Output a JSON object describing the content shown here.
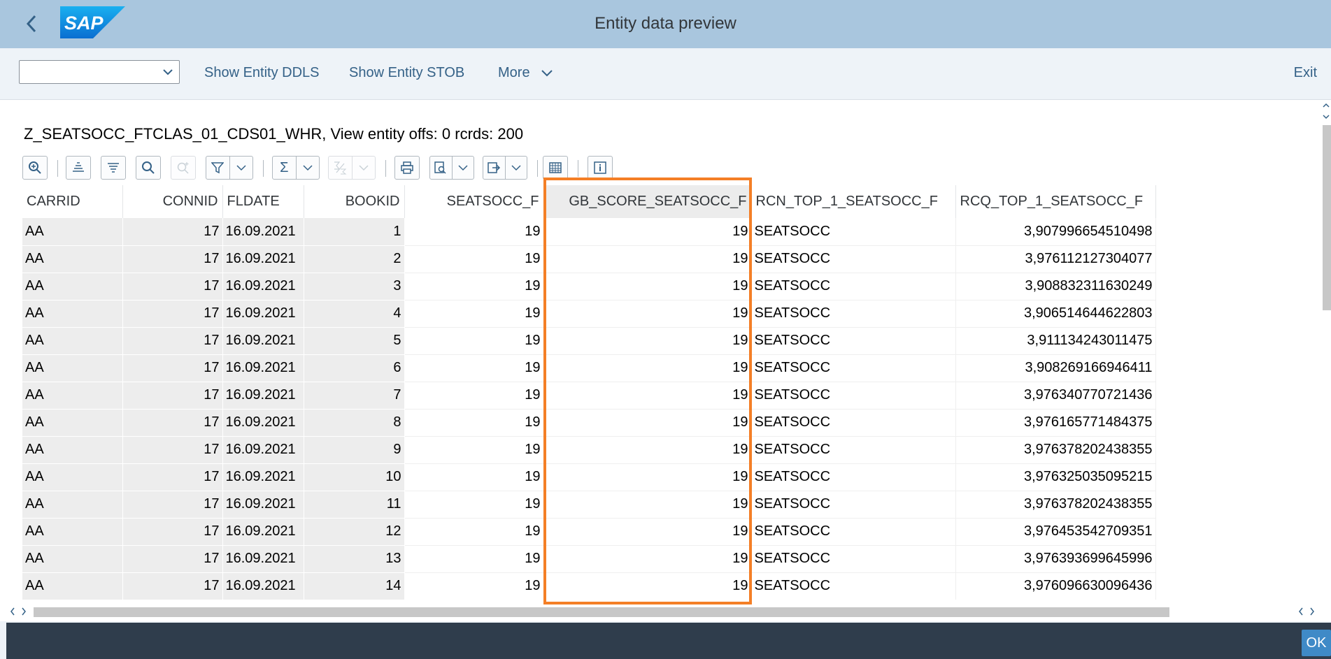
{
  "header": {
    "title": "Entity data preview",
    "logo_text": "SAP",
    "brand_color": "#0a6ed1"
  },
  "toolbar": {
    "select_value": "",
    "show_ddls": "Show Entity DDLS",
    "show_stob": "Show Entity STOB",
    "more": "More",
    "exit": "Exit"
  },
  "grid": {
    "title": "Z_SEATSOCC_FTCLAS_01_CDS01_WHR, View entity offs: 0  rcrds: 200",
    "columns": [
      "CARRID",
      "CONNID",
      "FLDATE",
      "BOOKID",
      "SEATSOCC_F",
      "GB_SCORE_SEATSOCC_F",
      "RCN_TOP_1_SEATSOCC_F",
      "RCQ_TOP_1_SEATSOCC_F"
    ],
    "rows": [
      [
        "AA",
        "17",
        "16.09.2021",
        "1",
        "19",
        "19",
        "SEATSOCC",
        "3,907996654510498"
      ],
      [
        "AA",
        "17",
        "16.09.2021",
        "2",
        "19",
        "19",
        "SEATSOCC",
        "3,976112127304077"
      ],
      [
        "AA",
        "17",
        "16.09.2021",
        "3",
        "19",
        "19",
        "SEATSOCC",
        "3,908832311630249"
      ],
      [
        "AA",
        "17",
        "16.09.2021",
        "4",
        "19",
        "19",
        "SEATSOCC",
        "3,906514644622803"
      ],
      [
        "AA",
        "17",
        "16.09.2021",
        "5",
        "19",
        "19",
        "SEATSOCC",
        "3,911134243011475"
      ],
      [
        "AA",
        "17",
        "16.09.2021",
        "6",
        "19",
        "19",
        "SEATSOCC",
        "3,908269166946411"
      ],
      [
        "AA",
        "17",
        "16.09.2021",
        "7",
        "19",
        "19",
        "SEATSOCC",
        "3,976340770721436"
      ],
      [
        "AA",
        "17",
        "16.09.2021",
        "8",
        "19",
        "19",
        "SEATSOCC",
        "3,976165771484375"
      ],
      [
        "AA",
        "17",
        "16.09.2021",
        "9",
        "19",
        "19",
        "SEATSOCC",
        "3,976378202438355"
      ],
      [
        "AA",
        "17",
        "16.09.2021",
        "10",
        "19",
        "19",
        "SEATSOCC",
        "3,976325035095215"
      ],
      [
        "AA",
        "17",
        "16.09.2021",
        "11",
        "19",
        "19",
        "SEATSOCC",
        "3,976378202438355"
      ],
      [
        "AA",
        "17",
        "16.09.2021",
        "12",
        "19",
        "19",
        "SEATSOCC",
        "3,976453542709351"
      ],
      [
        "AA",
        "17",
        "16.09.2021",
        "13",
        "19",
        "19",
        "SEATSOCC",
        "3,976393699645996"
      ],
      [
        "AA",
        "17",
        "16.09.2021",
        "14",
        "19",
        "19",
        "SEATSOCC",
        "3,976096630096436"
      ]
    ],
    "highlight_color": "#f47f26",
    "sum_symbol": "Σ"
  },
  "footer": {
    "ok": "OK"
  },
  "icons": {
    "back": "chevron-left-icon",
    "details": "magnifier-details-icon",
    "sort_asc": "sort-ascending-icon",
    "sort_desc": "sort-descending-icon",
    "find": "search-icon",
    "find_next": "search-next-icon",
    "filter": "filter-icon",
    "total": "sigma-icon",
    "subtotal": "subtotal-icon",
    "print": "print-icon",
    "views": "view-icon",
    "export": "export-icon",
    "layout": "grid-icon",
    "info": "info-icon"
  }
}
